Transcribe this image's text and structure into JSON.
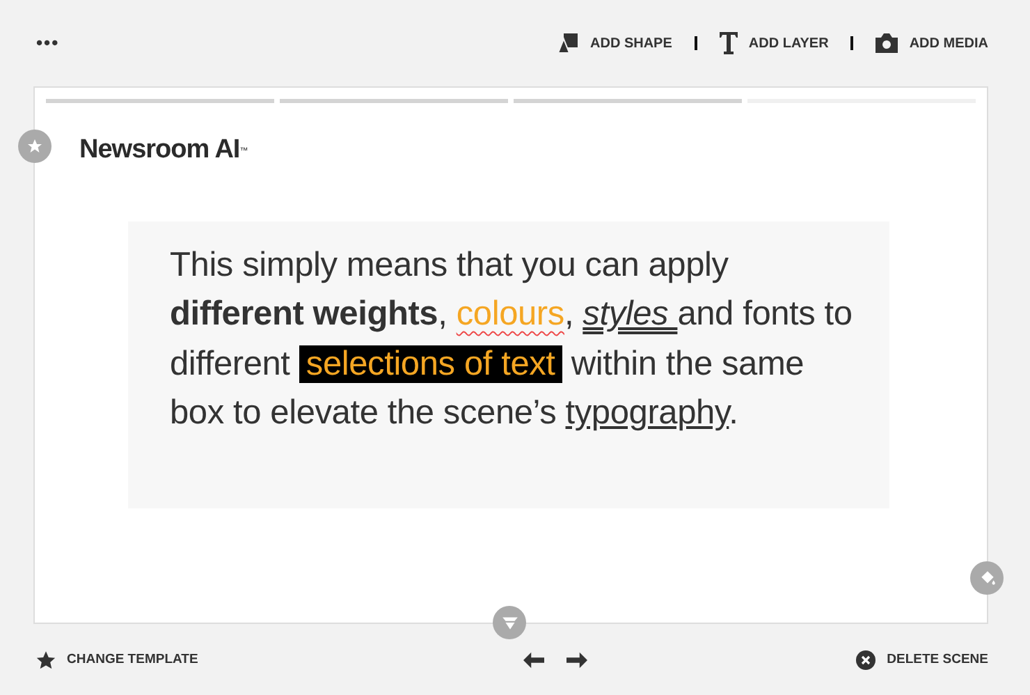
{
  "toolbar": {
    "more": "•••",
    "actions": [
      {
        "kind": "shape",
        "label": "ADD SHAPE"
      },
      {
        "kind": "layer",
        "label": "ADD LAYER"
      },
      {
        "kind": "media",
        "label": "ADD MEDIA"
      }
    ]
  },
  "progress": [
    {
      "done": true
    },
    {
      "done": true
    },
    {
      "done": true
    },
    {
      "done": false
    }
  ],
  "logo": {
    "text": "Newsroom AI",
    "mark": "™"
  },
  "paragraph": [
    {
      "kind": "plain",
      "text": "This simply means that you can apply "
    },
    {
      "kind": "bold",
      "text": "different weights"
    },
    {
      "kind": "plain",
      "text": ", "
    },
    {
      "kind": "orange",
      "text": "colours"
    },
    {
      "kind": "plain",
      "text": ", "
    },
    {
      "kind": "italic-underline",
      "text": "styles "
    },
    {
      "kind": "plain",
      "text": "and fonts to different "
    },
    {
      "kind": "highlight",
      "text": "selections of text"
    },
    {
      "kind": "plain",
      "text": " within the same box to elevate the scene’s "
    },
    {
      "kind": "underline",
      "text": "typography"
    },
    {
      "kind": "plain",
      "text": "."
    }
  ],
  "footer": {
    "change_template": "CHANGE TEMPLATE",
    "delete_scene": "DELETE SCENE"
  }
}
